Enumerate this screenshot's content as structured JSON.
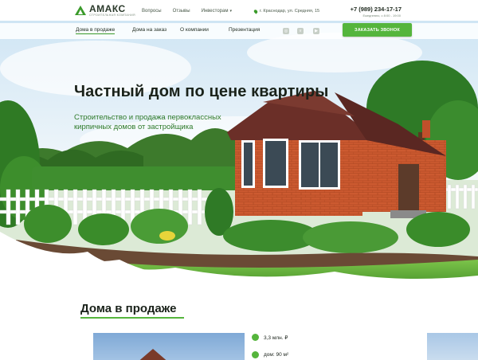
{
  "header": {
    "logo": {
      "name": "АМАКС",
      "tagline": "СТРОИТЕЛЬНАЯ КОМПАНИЯ"
    },
    "top_links": [
      "Вопросы",
      "Отзывы",
      "Инвесторам"
    ],
    "address": "г. Краснодар, ул. Средняя, 15",
    "phone": "+7 (989) 234-17-17",
    "hours": "Ежедневно, с 8:00 - 19:00",
    "nav": [
      "Дома в продаже",
      "Дома на заказ",
      "О компании",
      "Презентация"
    ],
    "social_icons": [
      "instagram-icon",
      "vk-icon",
      "youtube-icon"
    ],
    "cta_label": "ЗАКАЗАТЬ ЗВОНОК"
  },
  "hero": {
    "title": "Частный дом по цене квартиры",
    "subtitle_line1": "Строительство и продажа первоклассных",
    "subtitle_line2": "кирпичных домов  от застройщика"
  },
  "section": {
    "title": "Дома в продаже",
    "specs": [
      {
        "icon": "price-tag-icon",
        "text": "3,3 млн. ₽"
      },
      {
        "icon": "house-icon",
        "text": "дом:  90 м²"
      }
    ]
  },
  "colors": {
    "accent": "#55b53c",
    "brick": "#c8562e",
    "roof": "#6b2f28"
  }
}
